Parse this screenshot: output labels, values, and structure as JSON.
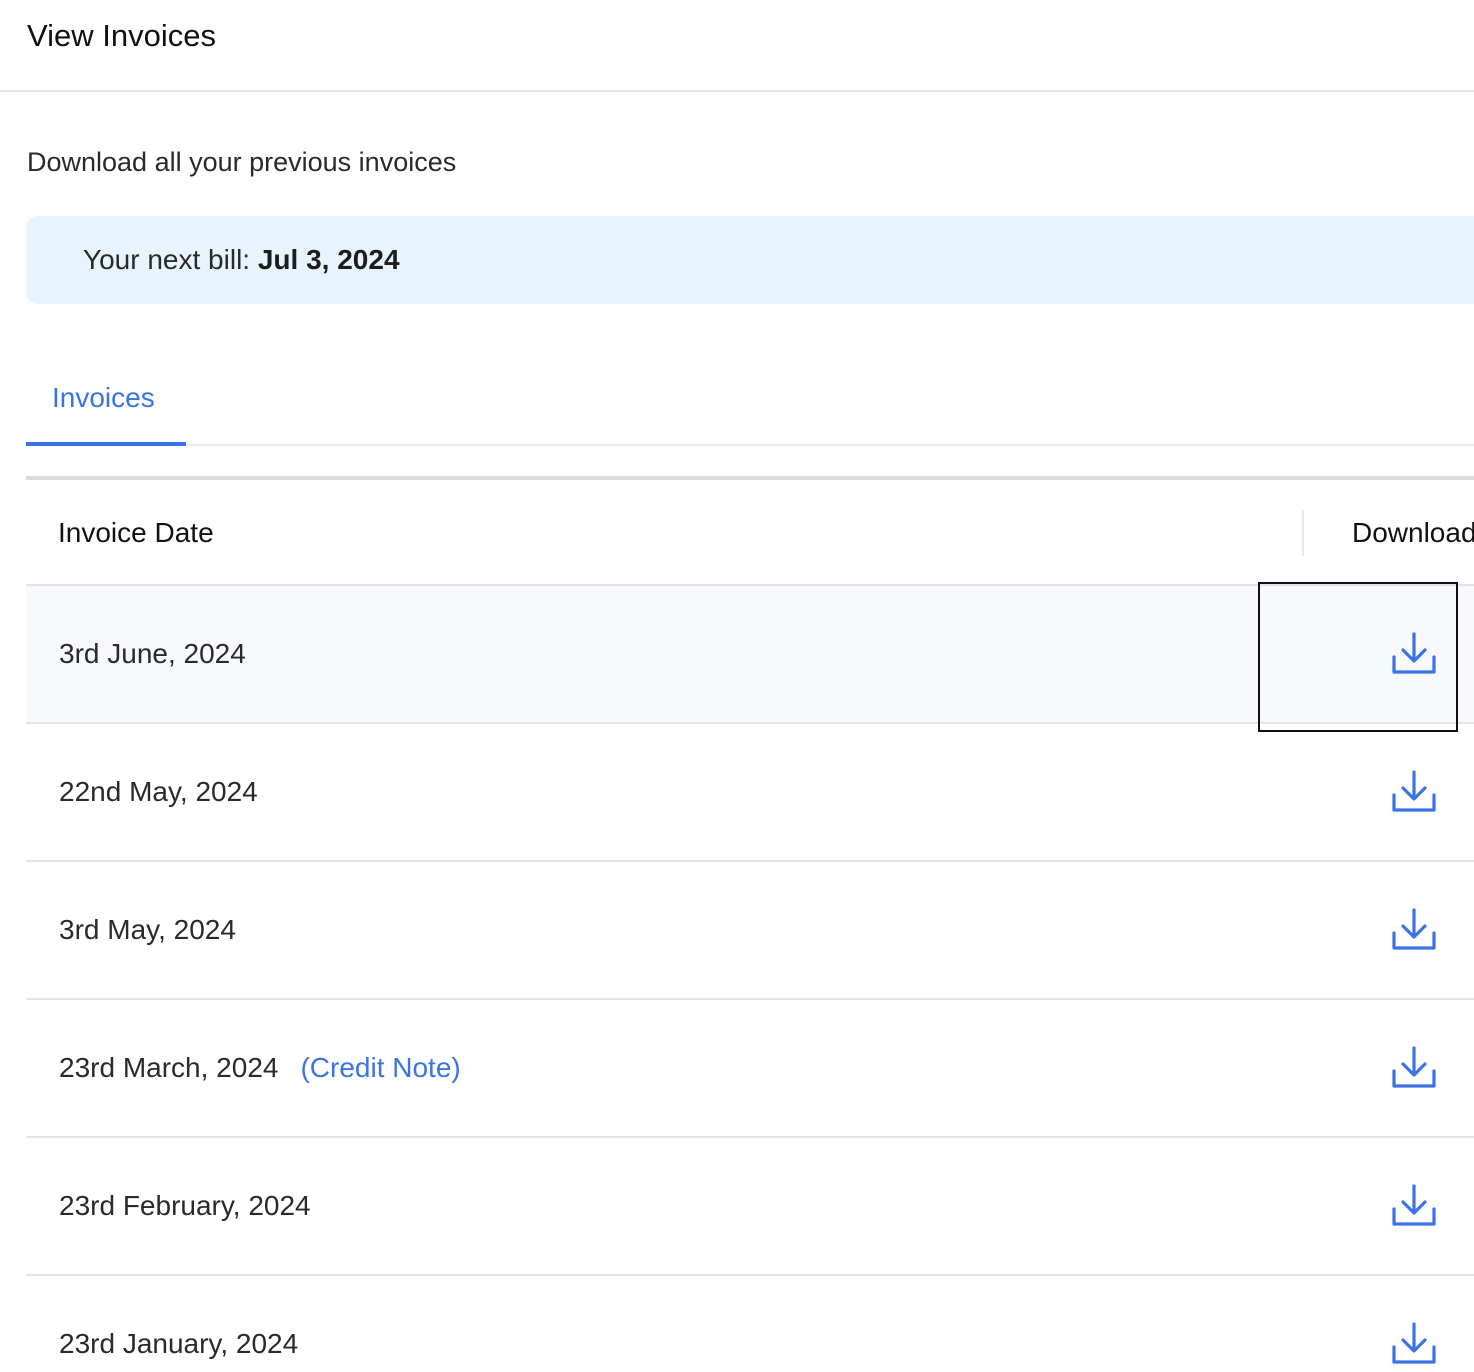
{
  "header": {
    "title": "View Invoices"
  },
  "subtitle": "Download all your previous invoices",
  "next_bill": {
    "label": "Your next bill: ",
    "date": "Jul 3, 2024"
  },
  "tabs": [
    {
      "label": "Invoices",
      "active": true
    }
  ],
  "table": {
    "columns": [
      "Invoice Date",
      "Download"
    ],
    "rows": [
      {
        "date": "3rd June, 2024",
        "note": ""
      },
      {
        "date": "22nd May, 2024",
        "note": ""
      },
      {
        "date": "3rd May, 2024",
        "note": ""
      },
      {
        "date": "23rd March, 2024",
        "note": "(Credit Note)"
      },
      {
        "date": "23rd February, 2024",
        "note": ""
      },
      {
        "date": "23rd January, 2024",
        "note": ""
      }
    ]
  },
  "icons": {
    "download": "download-icon"
  },
  "colors": {
    "accent": "#3b73e5",
    "banner_bg": "#e8f4fd",
    "row_hover_bg": "#f7f9fd"
  }
}
